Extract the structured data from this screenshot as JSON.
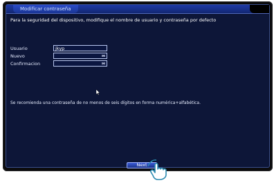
{
  "dialog": {
    "title": "Modificar contraseña",
    "info": "Para la seguridad del dispositivo, modifique el nombre de usuario y contraseña por defecto",
    "fields": [
      {
        "label": "Usuario",
        "value": "jkyp"
      },
      {
        "label": "Nuevo",
        "value": ""
      },
      {
        "label": "Confirmacion",
        "value": ""
      }
    ],
    "recommendation": "Se recomienda una contraseña de no menos de seis dígitos en forma numérica+alfabética.",
    "next_label": "Next"
  },
  "icons": {
    "field_keyboard": "keyboard-icon",
    "pointer": "mouse-pointer-icon",
    "hand": "tap-hand-icon"
  }
}
